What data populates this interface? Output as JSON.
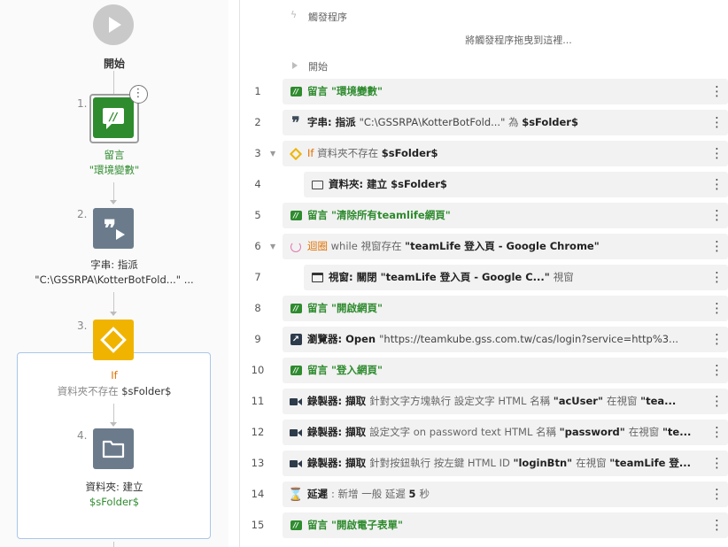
{
  "flow": {
    "start_label": "開始",
    "nodes": [
      {
        "num": "1.",
        "line1": "留言",
        "line2": "\"環境變數\""
      },
      {
        "num": "2.",
        "line1": "字串: 指派",
        "line2": "\"C:\\GSSRPA\\KotterBotFold...\" ..."
      },
      {
        "num": "3.",
        "line1": "If",
        "line2a": "資料夾不存在 ",
        "line2b": "$sFolder$"
      },
      {
        "num": "4.",
        "line1": "資料夾: 建立",
        "line2": "$sFolder$"
      }
    ],
    "colors": {
      "comment": "#2e8b2e",
      "string": "#6b7b8c",
      "if": "#f0b400",
      "folder": "#6b7b8c",
      "if_frame": "#a9c6ea"
    }
  },
  "list": {
    "trigger_label": "觸發程序",
    "trigger_hint": "將觸發程序拖曳到這裡...",
    "start_label": "開始",
    "rows": [
      {
        "num": "1",
        "icon": "comment-icon",
        "parts": [
          [
            "g",
            "留言 \"環境變數\""
          ]
        ]
      },
      {
        "num": "2",
        "icon": "quote-icon",
        "parts": [
          [
            "b",
            "字串: 指派 "
          ],
          [
            "op",
            "\"C:\\GSSRPA\\KotterBotFold...\" "
          ],
          [
            "",
            "為 "
          ],
          [
            "b",
            "$sFolder$"
          ]
        ]
      },
      {
        "num": "3",
        "caret": "▼",
        "icon": "diamond-icon",
        "parts": [
          [
            "o",
            "If "
          ],
          [
            "",
            "資料夾不存在 "
          ],
          [
            "b",
            "$sFolder$"
          ]
        ]
      },
      {
        "num": "4",
        "indent": 1,
        "icon": "folder-icon",
        "parts": [
          [
            "b",
            "資料夾: 建立 $sFolder$"
          ]
        ]
      },
      {
        "num": "5",
        "icon": "comment-icon",
        "parts": [
          [
            "g",
            "留言 \"清除所有teamlife網頁\""
          ]
        ]
      },
      {
        "num": "6",
        "caret": "▼",
        "icon": "loop-icon",
        "parts": [
          [
            "o",
            "迴圈 "
          ],
          [
            "",
            "while 視窗存在 "
          ],
          [
            "b",
            "\"teamLife 登入頁 - Google Chrome\""
          ]
        ]
      },
      {
        "num": "7",
        "indent": 1,
        "icon": "window-icon",
        "parts": [
          [
            "b",
            "視窗: 關閉 \"teamLife 登入頁 - Google C...\" "
          ],
          [
            "",
            "視窗"
          ]
        ]
      },
      {
        "num": "8",
        "icon": "comment-icon",
        "parts": [
          [
            "g",
            "留言 \"開啟網頁\""
          ]
        ]
      },
      {
        "num": "9",
        "icon": "open-link-icon",
        "parts": [
          [
            "b",
            "瀏覽器: Open "
          ],
          [
            "op",
            "\"https://teamkube.gss.com.tw/cas/login?service=http%3..."
          ]
        ]
      },
      {
        "num": "10",
        "icon": "comment-icon",
        "parts": [
          [
            "g",
            "留言 \"登入網頁\""
          ]
        ]
      },
      {
        "num": "11",
        "icon": "recorder-icon",
        "parts": [
          [
            "b",
            "錄製器: 擷取 "
          ],
          [
            "",
            "針對文字方塊執行 設定文字 HTML 名稱 "
          ],
          [
            "b",
            "\"acUser\" "
          ],
          [
            "",
            "在視窗 "
          ],
          [
            "b",
            "\"tea..."
          ]
        ]
      },
      {
        "num": "12",
        "icon": "recorder-icon",
        "parts": [
          [
            "b",
            "錄製器: 擷取 "
          ],
          [
            "",
            "設定文字 on password text HTML 名稱 "
          ],
          [
            "b",
            "\"password\" "
          ],
          [
            "",
            "在視窗 "
          ],
          [
            "b",
            "\"te..."
          ]
        ]
      },
      {
        "num": "13",
        "icon": "recorder-icon",
        "parts": [
          [
            "b",
            "錄製器: 擷取 "
          ],
          [
            "",
            "針對按鈕執行 按左鍵 HTML ID "
          ],
          [
            "b",
            "\"loginBtn\" "
          ],
          [
            "",
            "在視窗 "
          ],
          [
            "b",
            "\"teamLife 登..."
          ]
        ]
      },
      {
        "num": "14",
        "icon": "hourglass-icon",
        "parts": [
          [
            "b",
            "延遲 "
          ],
          [
            "",
            ": 新增 一般 延遲 "
          ],
          [
            "b",
            "5 "
          ],
          [
            "",
            "秒"
          ]
        ]
      },
      {
        "num": "15",
        "icon": "comment-icon",
        "parts": [
          [
            "g",
            "留言 \"開啟電子表單\""
          ]
        ]
      }
    ]
  }
}
